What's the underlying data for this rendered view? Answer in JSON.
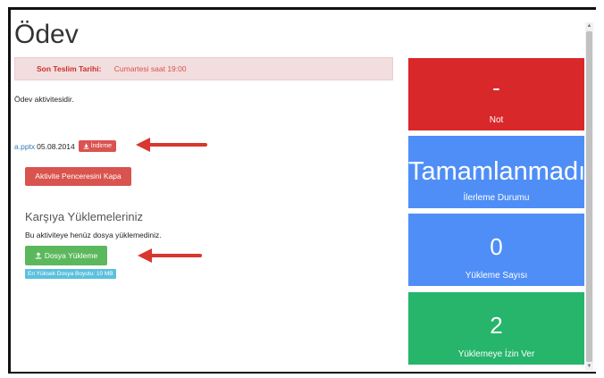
{
  "page": {
    "title": "Ödev",
    "deadline": {
      "label": "Son Teslim Tarihi:",
      "value": "Cumartesi saat 19:00"
    },
    "description": "Ödev aktivitesidir.",
    "file": {
      "name": "a.pptx",
      "date": "05.08.2014",
      "download_label": "İndirme",
      "download_icon": "download-icon"
    },
    "close_button": "Aktivite Penceresini Kapa",
    "uploads": {
      "heading": "Karşıya Yüklemeleriniz",
      "note": "Bu aktiviteye henüz dosya yüklemediniz.",
      "upload_button": "Dosya Yükleme",
      "upload_icon": "upload-icon",
      "max_size_badge": "En Yüksek Dosya Boyutu: 10 MB"
    }
  },
  "tiles": {
    "grade": {
      "value": "-",
      "label": "Not"
    },
    "progress": {
      "value": "Tamamlanmadı",
      "label": "İlerleme Durumu"
    },
    "upload_count": {
      "value": "0",
      "label": "Yükleme Sayısı"
    },
    "allowed": {
      "value": "2",
      "label": "Yüklemeye İzin Ver"
    }
  },
  "colors": {
    "red_tile": "#d9282a",
    "blue_tile": "#4f8ef7",
    "green_tile": "#26b56b",
    "danger_button": "#d9534f",
    "success_button": "#5cb85c",
    "info_badge": "#5bc0de",
    "arrow": "#d9362e"
  }
}
